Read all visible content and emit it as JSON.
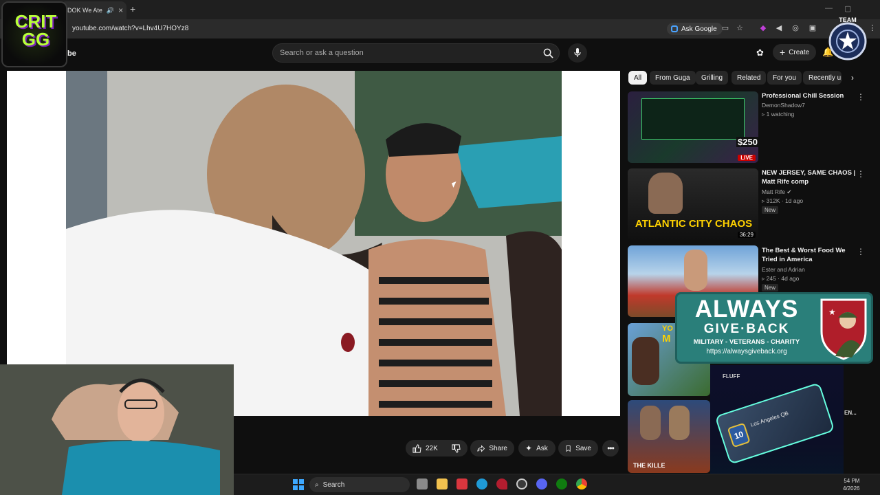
{
  "browser": {
    "tab_title": "DOK We Ate",
    "url": "youtube.com/watch?v=Lhv4U7HOYz8",
    "ask_google": "Ask Google"
  },
  "header": {
    "logo_fragment": "be",
    "search_placeholder": "Search or ask a question",
    "create_label": "Create"
  },
  "actions": {
    "likes": "22K",
    "share": "Share",
    "ask": "Ask",
    "save": "Save"
  },
  "chips": [
    "All",
    "From Guga",
    "Grilling",
    "Related",
    "For you",
    "Recently up"
  ],
  "recommendations": [
    {
      "title": "Professional Chill Session",
      "channel": "DemonShadow7",
      "meta": "1 watching",
      "badge": "LIVE",
      "thumb_text": "$250"
    },
    {
      "title": "NEW JERSEY, SAME CHAOS | Matt Rife comp",
      "channel": "Matt Rife",
      "meta": "312K · 1d ago",
      "new": "New",
      "duration": "36:29",
      "thumb_text": "ATLANTIC CITY CHAOS"
    },
    {
      "title": "The Best & Worst Food We Tried in America",
      "channel": "Ester and Adrian",
      "meta": "245 · 4d ago",
      "new": "New"
    }
  ],
  "overlays": {
    "critgg": "CRIT GG",
    "team": "TEAM",
    "agb_line1": "ALWAYS",
    "agb_line2": "GIVE·BACK",
    "agb_sub": "MILITARY - VETERANS - CHARITY",
    "agb_url": "https://alwaysgiveback.org",
    "fluff_brand": "FLUFF",
    "fluff_card": "Los Angeles QB",
    "fluff_number": "10",
    "rec4_frag": "YO",
    "rec4_m": "M",
    "rec5_frag": "THE KILLE",
    "rec_edge": "EN..."
  },
  "taskbar": {
    "search": "Search",
    "time": "54 PM",
    "date": "4/2026"
  }
}
